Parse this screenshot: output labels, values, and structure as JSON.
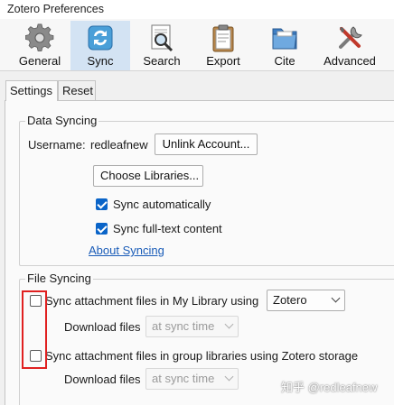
{
  "window": {
    "title": "Zotero Preferences"
  },
  "toolbar": {
    "items": [
      {
        "label": "General",
        "icon": "gear-icon"
      },
      {
        "label": "Sync",
        "icon": "sync-icon"
      },
      {
        "label": "Search",
        "icon": "search-icon"
      },
      {
        "label": "Export",
        "icon": "clipboard-icon"
      },
      {
        "label": "Cite",
        "icon": "folder-icon"
      },
      {
        "label": "Advanced",
        "icon": "tools-icon"
      }
    ],
    "active": "Sync"
  },
  "tabs": [
    {
      "label": "Settings",
      "selected": true
    },
    {
      "label": "Reset",
      "selected": false
    }
  ],
  "data_syncing": {
    "title": "Data Syncing",
    "username_label": "Username:",
    "username_value": "redleafnew",
    "unlink_button": "Unlink Account...",
    "choose_libraries_button": "Choose Libraries...",
    "sync_automatically": {
      "label": "Sync automatically",
      "checked": true
    },
    "sync_fulltext": {
      "label": "Sync full-text content",
      "checked": true
    },
    "about_link": "About Syncing"
  },
  "file_syncing": {
    "title": "File Syncing",
    "my_library": {
      "label": "Sync attachment files in My Library using",
      "checked": false,
      "method": "Zotero",
      "download_label": "Download files",
      "download_value": "at sync time"
    },
    "group_libraries": {
      "label": "Sync attachment files in group libraries using Zotero storage",
      "checked": false,
      "download_label": "Download files",
      "download_value": "at sync time"
    }
  },
  "watermark": "知乎 @redleafnew",
  "colors": {
    "accent": "#0a64c8",
    "highlight_box": "#e02020",
    "active_tab_bg": "#d3e3f3",
    "link": "#1a5cb8"
  }
}
